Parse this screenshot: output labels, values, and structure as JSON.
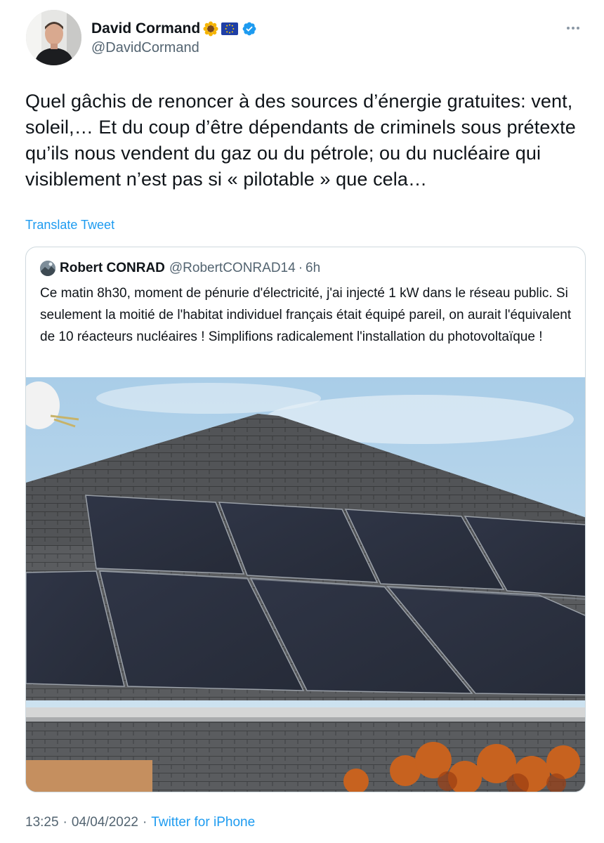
{
  "author": {
    "name": "David Cormand",
    "handle": "@DavidCormand"
  },
  "tweet": {
    "text": "Quel gâchis de renoncer à des sources d’énergie gratuites: vent, soleil,… Et du coup d’être dépendants de criminels sous prétexte qu’ils nous vendent du gaz ou du pétrole; ou du nucléaire qui visiblement n’est pas si « pilotable » que  cela…",
    "translate_label": "Translate Tweet",
    "time": "13:25",
    "date": "04/04/2022",
    "separator": "·",
    "source": "Twitter for iPhone"
  },
  "quote": {
    "name": "Robert CONRAD",
    "handle": "@RobertCONRAD14",
    "separator": "·",
    "time": "6h",
    "text": "Ce matin 8h30, moment de pénurie d'électricité, j'ai injecté 1 kW dans le réseau public. Si seulement la moitié de l'habitat individuel français était équipé pareil, on aurait l'équivalent de 10 réacteurs nucléaires ! Simplifions radicalement l'installation du photovoltaïque  !"
  },
  "icons": {
    "flags": [
      "sunflower-icon",
      "eu-flag-icon"
    ],
    "verified": "verified-badge-icon",
    "more": "more-options-icon"
  },
  "colors": {
    "link": "#1d9bf0",
    "verified": "#1d9bf0",
    "secondary_text": "#536471",
    "border": "#cfd9de"
  }
}
